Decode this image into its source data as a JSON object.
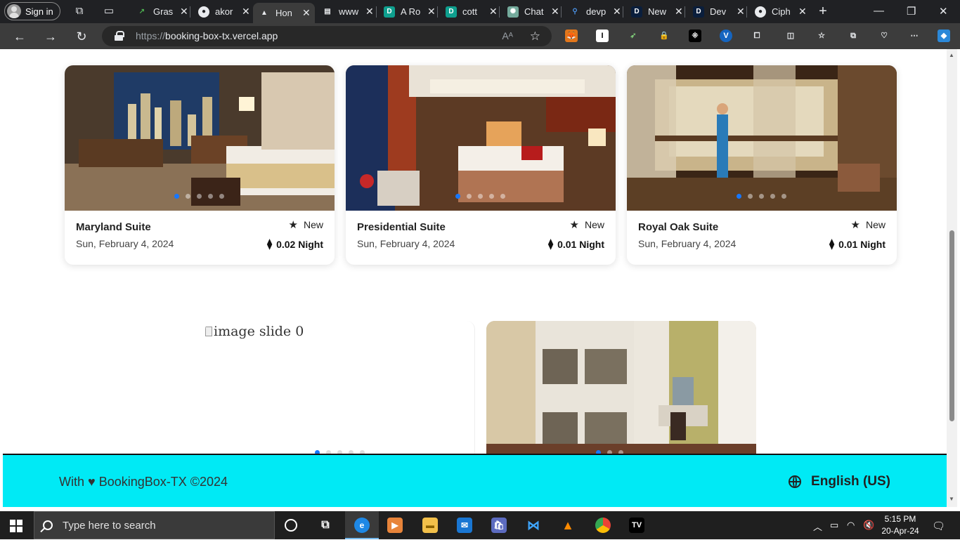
{
  "browser": {
    "signin_label": "Sign in",
    "tabs": [
      {
        "label": "Gras",
        "favicon": "chart-icon",
        "color": "#2e7d32"
      },
      {
        "label": "akor",
        "favicon": "github-icon",
        "color": "#e8eaed"
      },
      {
        "label": "Hon",
        "favicon": "vercel-icon",
        "color": "#000000",
        "active": true
      },
      {
        "label": "www",
        "favicon": "doc-icon",
        "color": "#e8eaed"
      },
      {
        "label": "A Ro",
        "favicon": "d-icon",
        "color": "#0e9f8e"
      },
      {
        "label": "cott",
        "favicon": "d-icon",
        "color": "#0e9f8e"
      },
      {
        "label": "Chat",
        "favicon": "chatgpt-icon",
        "color": "#74aa9c"
      },
      {
        "label": "devp",
        "favicon": "search-icon",
        "color": "#1a73e8"
      },
      {
        "label": "New",
        "favicon": "d-icon",
        "color": "#0a1e3c"
      },
      {
        "label": "Dev",
        "favicon": "d-icon",
        "color": "#0a1e3c"
      },
      {
        "label": "Ciph",
        "favicon": "github-icon",
        "color": "#e8eaed"
      }
    ],
    "url_scheme": "https://",
    "url_host": "booking-box-tx.vercel.app"
  },
  "rooms": [
    {
      "title": "Maryland Suite",
      "date": "Sun, February 4, 2024",
      "badge": "New",
      "price": "0.02 Night"
    },
    {
      "title": "Presidential Suite",
      "date": "Sun, February 4, 2024",
      "badge": "New",
      "price": "0.01 Night"
    },
    {
      "title": "Royal Oak Suite",
      "date": "Sun, February 4, 2024",
      "badge": "New",
      "price": "0.01 Night"
    }
  ],
  "second_row": {
    "broken_image_alt": "image slide 0"
  },
  "footer": {
    "copyright": "With ♥ BookingBox-TX ©2024",
    "language": "English (US)"
  },
  "taskbar": {
    "search_placeholder": "Type here to search",
    "time": "5:15 PM",
    "date": "20-Apr-24"
  },
  "colors": {
    "accent": "#1677ff",
    "footer_bg": "#00eaf5"
  }
}
